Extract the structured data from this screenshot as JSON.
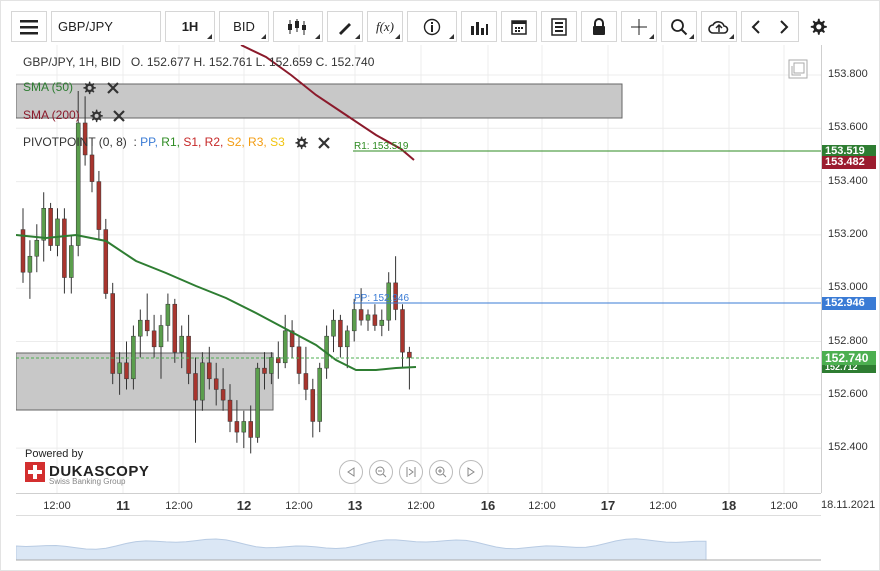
{
  "toolbar": {
    "menu_icon": "hamburger-menu-icon",
    "symbol": "GBP/JPY",
    "period": "1H",
    "price_type": "BID"
  },
  "header": {
    "symbol_line": "GBP/JPY, 1H, BID",
    "ohlc": "O. 152.677  H. 152.761  L. 152.659  C. 152.740"
  },
  "indicators": {
    "sma50": "SMA (50)",
    "sma200": "SMA (200)",
    "pivot": "PIVOTPOINT (0, 8)",
    "pivot_levels": [
      {
        "label": "PP",
        "color": "#3a7bd5"
      },
      {
        "label": "R1",
        "color": "#2e8b22"
      },
      {
        "label": "S1",
        "color": "#c62828"
      },
      {
        "label": "R2",
        "color": "#c62828"
      },
      {
        "label": "S2",
        "color": "#f39c12"
      },
      {
        "label": "R3",
        "color": "#f39c12"
      },
      {
        "label": "S3",
        "color": "#f1c40f"
      }
    ],
    "pp_label": "PP: 152.946",
    "r1_label": "R1: 153.519"
  },
  "price_axis": {
    "ticks": [
      "153.800",
      "153.600",
      "153.400",
      "153.200",
      "153.000",
      "152.800",
      "152.600",
      "152.400"
    ],
    "tags": {
      "r1": {
        "text": "153.519",
        "color": "#2e7d32"
      },
      "sma200": {
        "text": "153.482",
        "color": "#9b1c2e"
      },
      "pp": {
        "text": "152.946",
        "color": "#3a7bd5"
      },
      "close": {
        "text": "152.740",
        "color": "#4caf50"
      },
      "sma50": {
        "text": "152.712",
        "color": "#2e7d32"
      }
    }
  },
  "time_axis": {
    "ticks": [
      {
        "label": "12:00",
        "major": false
      },
      {
        "label": "11",
        "major": true
      },
      {
        "label": "12:00",
        "major": false
      },
      {
        "label": "12",
        "major": true
      },
      {
        "label": "12:00",
        "major": false
      },
      {
        "label": "13",
        "major": true
      },
      {
        "label": "12:00",
        "major": false
      },
      {
        "label": "16",
        "major": true
      },
      {
        "label": "12:00",
        "major": false
      },
      {
        "label": "17",
        "major": true
      },
      {
        "label": "12:00",
        "major": false
      },
      {
        "label": "18",
        "major": true
      },
      {
        "label": "12:00",
        "major": false
      }
    ],
    "date": "18.11.2021"
  },
  "branding": {
    "powered_by": "Powered by",
    "name": "DUKASCOPY",
    "sub": "Swiss Banking Group"
  },
  "colors": {
    "sma50": "#2e7d32",
    "sma200": "#8b1a2b",
    "bull": "#5b9e4d",
    "bear": "#a8352e"
  }
}
